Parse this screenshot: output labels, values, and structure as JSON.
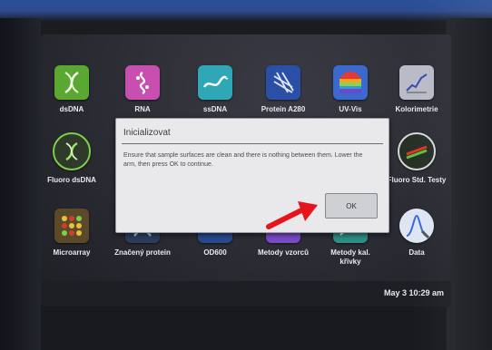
{
  "tiles": [
    {
      "label": "dsDNA",
      "icon": "dna-helix-icon"
    },
    {
      "label": "RNA",
      "icon": "rna-strand-icon"
    },
    {
      "label": "ssDNA",
      "icon": "ssdna-icon"
    },
    {
      "label": "Protein A280",
      "icon": "protein-icon"
    },
    {
      "label": "UV-Vis",
      "icon": "spectrum-icon"
    },
    {
      "label": "Kolorimetrie",
      "icon": "colorimetry-icon"
    },
    {
      "label": "Fluoro dsDNA",
      "icon": "fluoro-dna-icon"
    },
    {
      "label": "Fluoro Std. Testy",
      "icon": "fluoro-test-icon"
    },
    {
      "label": "Microarray",
      "icon": "microarray-icon"
    },
    {
      "label": "Značený protein",
      "icon": "labeled-protein-icon"
    },
    {
      "label": "OD600",
      "icon": "od600-icon"
    },
    {
      "label": "Metody vzorců",
      "icon": "formula-methods-icon"
    },
    {
      "label": "Metody kal. křivky",
      "icon": "calibration-curve-icon"
    },
    {
      "label": "Data",
      "icon": "data-icon"
    }
  ],
  "dialog": {
    "title": "Inicializovat",
    "message": "Ensure that sample surfaces are clean and there is nothing between them. Lower the arm, then press OK to continue.",
    "ok_label": "OK"
  },
  "status": {
    "clock": "May 3 10:29 am"
  },
  "colors": {
    "annotation_arrow": "#e8141c"
  }
}
